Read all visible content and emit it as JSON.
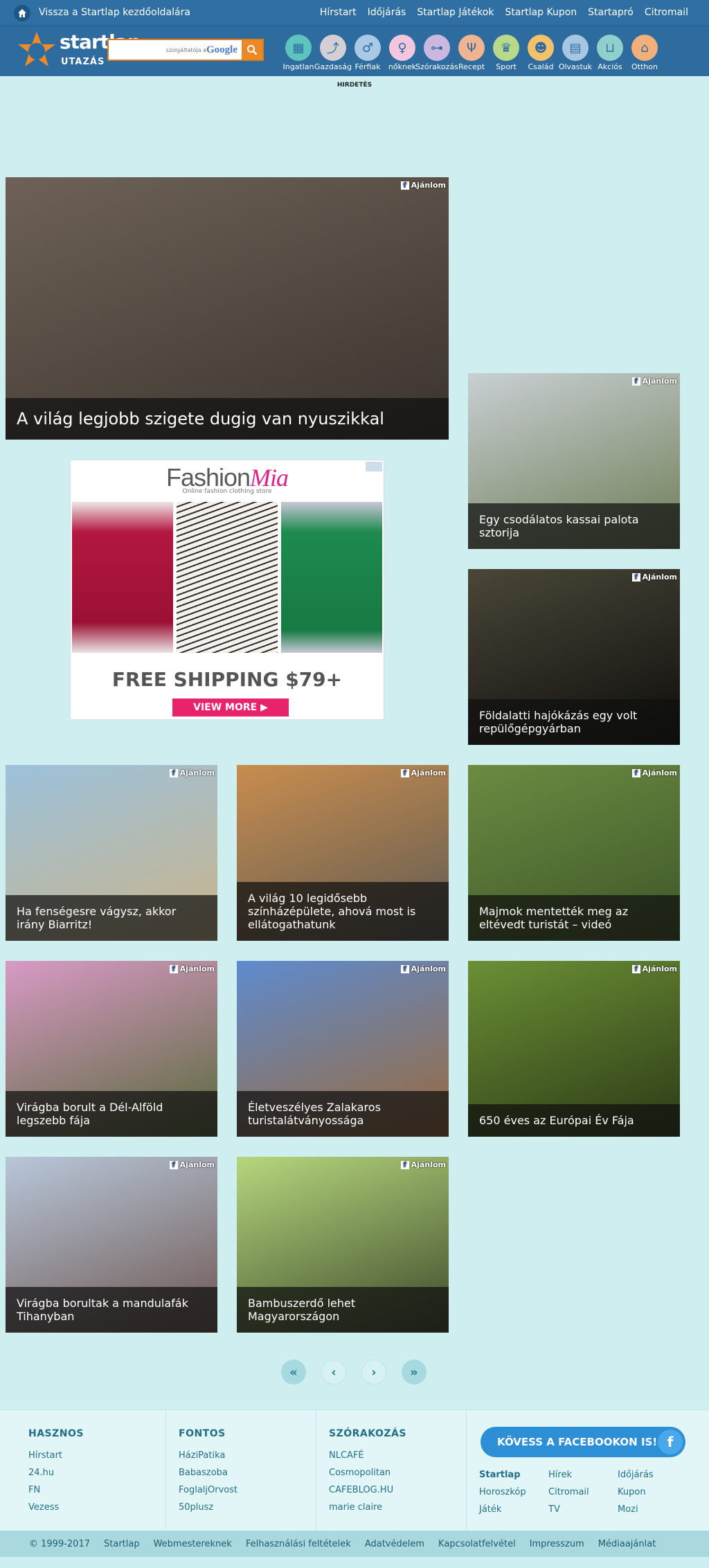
{
  "topnav": {
    "back_label": "Vissza a Startlap kezdőoldalára",
    "links": [
      "Hírstart",
      "Időjárás",
      "Startlap Játékok",
      "Startlap Kupon",
      "Startapró",
      "Citromail"
    ]
  },
  "header": {
    "logo_text": "startlap",
    "section": "UTAZÁS",
    "search_placeholder": "szolgáltatója a",
    "search_brand": "Google",
    "categories": [
      {
        "label": "Ingatlan",
        "icon": "building-icon",
        "color": "#5fc3bf",
        "glyph": "▦"
      },
      {
        "label": "Gazdaság",
        "icon": "chart-icon",
        "color": "#d3cfd4",
        "glyph": "⤴"
      },
      {
        "label": "Férfiak",
        "icon": "male-icon",
        "color": "#a9c9e6",
        "glyph": "♂"
      },
      {
        "label": "nőknek",
        "icon": "female-icon",
        "color": "#f2c7de",
        "glyph": "♀"
      },
      {
        "label": "Szórakozás",
        "icon": "gamepad-icon",
        "color": "#cab8df",
        "glyph": "⊶"
      },
      {
        "label": "Recept",
        "icon": "cutlery-icon",
        "color": "#f0b590",
        "glyph": "Ψ"
      },
      {
        "label": "Sport",
        "icon": "trophy-icon",
        "color": "#b9d98a",
        "glyph": "♛"
      },
      {
        "label": "Család",
        "icon": "family-icon",
        "color": "#f3c169",
        "glyph": "☻"
      },
      {
        "label": "Olvastuk",
        "icon": "newspaper-icon",
        "color": "#a6c6e1",
        "glyph": "▤"
      },
      {
        "label": "Akciós",
        "icon": "basket-icon",
        "color": "#8fd0cc",
        "glyph": "⊔"
      },
      {
        "label": "Otthon",
        "icon": "home-furniture-icon",
        "color": "#f1b07b",
        "glyph": "⌂"
      }
    ]
  },
  "ad_label": "HIRDETÉS",
  "like_label": "Ajánlom",
  "articles": [
    {
      "title": "A világ legjobb szigete dugig van nyuszikkal",
      "c1": "#6e6257",
      "c2": "#3a332d"
    },
    {
      "title": "Egy csodálatos kassai palota sztorija",
      "c1": "#c9cfd3",
      "c2": "#6e7c55"
    },
    {
      "title": "Földalatti hajókázás egy volt repülőgépgyárban",
      "c1": "#4a4638",
      "c2": "#0d0d0b"
    },
    {
      "title": "Ha fenségesre vágysz, akkor irány Biarritz!",
      "c1": "#9cc2dc",
      "c2": "#c9b38a"
    },
    {
      "title": "A világ 10 legidősebb színházépülete, ahová most is ellátogathatunk",
      "c1": "#c98d4e",
      "c2": "#5d5a53"
    },
    {
      "title": "Majmok mentették meg az eltévedt turistát – videó",
      "c1": "#6c8b41",
      "c2": "#3e5628"
    },
    {
      "title": "Virágba borult a Dél-Alföld legszebb fája",
      "c1": "#d89ac5",
      "c2": "#57683a"
    },
    {
      "title": "Életveszélyes Zalakaros turistalátványossága",
      "c1": "#5e8bcf",
      "c2": "#9a6a3a"
    },
    {
      "title": "650 éves az Európai Év Fája",
      "c1": "#6b8f35",
      "c2": "#2c3a16"
    },
    {
      "title": "Virágba borultak a mandulafák Tihanyban",
      "c1": "#b8c7da",
      "c2": "#6d5650"
    },
    {
      "title": "Bambuszerdő lehet Magyarországon",
      "c1": "#b6d77d",
      "c2": "#3d4a2b"
    }
  ],
  "ad": {
    "brand_main": "Fashion",
    "brand_accent": "Mia",
    "tagline": "Online fashion clothing store",
    "shipping": "FREE SHIPPING $79+",
    "cta": "VIEW MORE ▶"
  },
  "pager": [
    "«",
    "‹",
    "›",
    "»"
  ],
  "footer": {
    "cols": [
      {
        "title": "HASZNOS",
        "links": [
          "Hírstart",
          "24.hu",
          "FN",
          "Vezess"
        ]
      },
      {
        "title": "FONTOS",
        "links": [
          "HáziPatika",
          "Babaszoba",
          "FoglaljOrvost",
          "50plusz"
        ]
      },
      {
        "title": "SZÓRAKOZÁS",
        "links": [
          "NLCAFÉ",
          "Cosmopolitan",
          "CAFEBLOG.HU",
          "marie claire"
        ]
      }
    ],
    "facebook_cta": "KÖVESS A FACEBOOKON IS!",
    "grid": [
      "Startlap",
      "Hírek",
      "Időjárás",
      "Horoszkóp",
      "Citromail",
      "Kupon",
      "Játék",
      "TV",
      "Mozi"
    ]
  },
  "bottombar": [
    "© 1999-2017",
    "Startlap",
    "Webmestereknek",
    "Felhasználási feltételek",
    "Adatvédelem",
    "Kapcsolatfelvétel",
    "Impresszum",
    "Médiaajánlat"
  ]
}
